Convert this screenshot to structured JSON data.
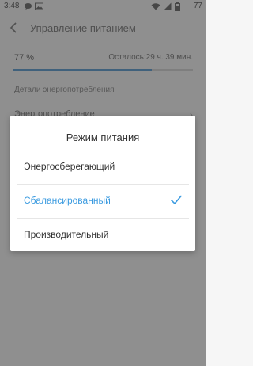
{
  "status": {
    "time": "3:48",
    "battery": "77"
  },
  "header": {
    "title": "Управление питанием"
  },
  "battery": {
    "percent": "77 %",
    "remaining": "Осталось:29 ч. 39 мин.",
    "level": 0.77
  },
  "details": {
    "section_title": "Детали энергопотребления",
    "item": "Энергопотребление"
  },
  "dialog": {
    "title": "Режим питания",
    "options": [
      {
        "label": "Энергосберегающий",
        "selected": false
      },
      {
        "label": "Сбалансированный",
        "selected": true
      },
      {
        "label": "Производительный",
        "selected": false
      }
    ]
  },
  "colors": {
    "accent": "#3b9be0",
    "progress": "#6ea7d6"
  },
  "icons": [
    "chat-icon",
    "gallery-icon",
    "wifi-icon",
    "signal-icon",
    "battery-icon",
    "back-arrow-icon",
    "chevron-right-icon",
    "checkmark-icon"
  ]
}
